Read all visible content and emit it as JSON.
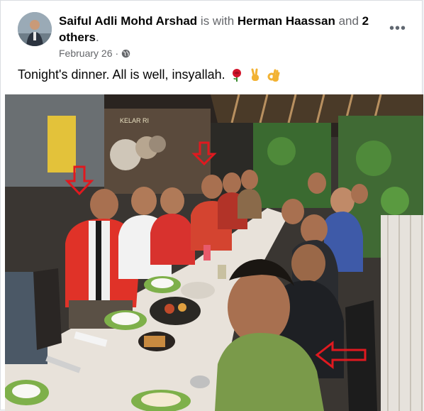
{
  "post": {
    "author": "Saiful Adli Mohd Arshad",
    "with_text": " is with ",
    "tagged_person": "Herman Haassan",
    "and_text": " and ",
    "others": "2 others",
    "period": ".",
    "date": "February 26",
    "dot": "·",
    "privacy_icon": "globe-icon",
    "menu_icon": "more-options-icon",
    "menu_glyph": "•••",
    "caption": "Tonight's dinner. All is well, insyallah.",
    "emojis": [
      "rose-icon",
      "victory-hand-icon",
      "ok-hand-icon"
    ]
  },
  "photo": {
    "sign_text": "KELAR RI",
    "arrow_color": "#e0191f"
  }
}
